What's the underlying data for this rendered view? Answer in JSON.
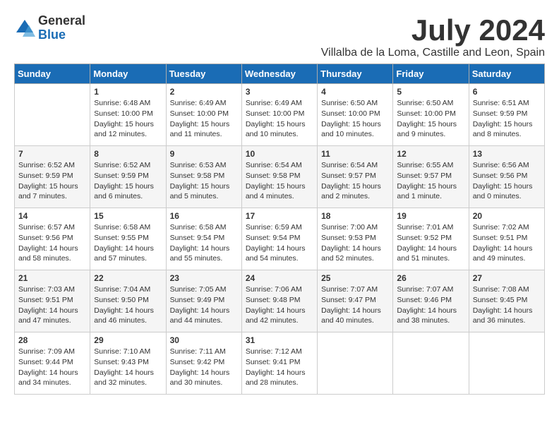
{
  "logo": {
    "general": "General",
    "blue": "Blue"
  },
  "title": "July 2024",
  "location": "Villalba de la Loma, Castille and Leon, Spain",
  "days_header": [
    "Sunday",
    "Monday",
    "Tuesday",
    "Wednesday",
    "Thursday",
    "Friday",
    "Saturday"
  ],
  "weeks": [
    [
      {
        "num": "",
        "info": ""
      },
      {
        "num": "1",
        "info": "Sunrise: 6:48 AM\nSunset: 10:00 PM\nDaylight: 15 hours\nand 12 minutes."
      },
      {
        "num": "2",
        "info": "Sunrise: 6:49 AM\nSunset: 10:00 PM\nDaylight: 15 hours\nand 11 minutes."
      },
      {
        "num": "3",
        "info": "Sunrise: 6:49 AM\nSunset: 10:00 PM\nDaylight: 15 hours\nand 10 minutes."
      },
      {
        "num": "4",
        "info": "Sunrise: 6:50 AM\nSunset: 10:00 PM\nDaylight: 15 hours\nand 10 minutes."
      },
      {
        "num": "5",
        "info": "Sunrise: 6:50 AM\nSunset: 10:00 PM\nDaylight: 15 hours\nand 9 minutes."
      },
      {
        "num": "6",
        "info": "Sunrise: 6:51 AM\nSunset: 9:59 PM\nDaylight: 15 hours\nand 8 minutes."
      }
    ],
    [
      {
        "num": "7",
        "info": "Sunrise: 6:52 AM\nSunset: 9:59 PM\nDaylight: 15 hours\nand 7 minutes."
      },
      {
        "num": "8",
        "info": "Sunrise: 6:52 AM\nSunset: 9:59 PM\nDaylight: 15 hours\nand 6 minutes."
      },
      {
        "num": "9",
        "info": "Sunrise: 6:53 AM\nSunset: 9:58 PM\nDaylight: 15 hours\nand 5 minutes."
      },
      {
        "num": "10",
        "info": "Sunrise: 6:54 AM\nSunset: 9:58 PM\nDaylight: 15 hours\nand 4 minutes."
      },
      {
        "num": "11",
        "info": "Sunrise: 6:54 AM\nSunset: 9:57 PM\nDaylight: 15 hours\nand 2 minutes."
      },
      {
        "num": "12",
        "info": "Sunrise: 6:55 AM\nSunset: 9:57 PM\nDaylight: 15 hours\nand 1 minute."
      },
      {
        "num": "13",
        "info": "Sunrise: 6:56 AM\nSunset: 9:56 PM\nDaylight: 15 hours\nand 0 minutes."
      }
    ],
    [
      {
        "num": "14",
        "info": "Sunrise: 6:57 AM\nSunset: 9:56 PM\nDaylight: 14 hours\nand 58 minutes."
      },
      {
        "num": "15",
        "info": "Sunrise: 6:58 AM\nSunset: 9:55 PM\nDaylight: 14 hours\nand 57 minutes."
      },
      {
        "num": "16",
        "info": "Sunrise: 6:58 AM\nSunset: 9:54 PM\nDaylight: 14 hours\nand 55 minutes."
      },
      {
        "num": "17",
        "info": "Sunrise: 6:59 AM\nSunset: 9:54 PM\nDaylight: 14 hours\nand 54 minutes."
      },
      {
        "num": "18",
        "info": "Sunrise: 7:00 AM\nSunset: 9:53 PM\nDaylight: 14 hours\nand 52 minutes."
      },
      {
        "num": "19",
        "info": "Sunrise: 7:01 AM\nSunset: 9:52 PM\nDaylight: 14 hours\nand 51 minutes."
      },
      {
        "num": "20",
        "info": "Sunrise: 7:02 AM\nSunset: 9:51 PM\nDaylight: 14 hours\nand 49 minutes."
      }
    ],
    [
      {
        "num": "21",
        "info": "Sunrise: 7:03 AM\nSunset: 9:51 PM\nDaylight: 14 hours\nand 47 minutes."
      },
      {
        "num": "22",
        "info": "Sunrise: 7:04 AM\nSunset: 9:50 PM\nDaylight: 14 hours\nand 46 minutes."
      },
      {
        "num": "23",
        "info": "Sunrise: 7:05 AM\nSunset: 9:49 PM\nDaylight: 14 hours\nand 44 minutes."
      },
      {
        "num": "24",
        "info": "Sunrise: 7:06 AM\nSunset: 9:48 PM\nDaylight: 14 hours\nand 42 minutes."
      },
      {
        "num": "25",
        "info": "Sunrise: 7:07 AM\nSunset: 9:47 PM\nDaylight: 14 hours\nand 40 minutes."
      },
      {
        "num": "26",
        "info": "Sunrise: 7:07 AM\nSunset: 9:46 PM\nDaylight: 14 hours\nand 38 minutes."
      },
      {
        "num": "27",
        "info": "Sunrise: 7:08 AM\nSunset: 9:45 PM\nDaylight: 14 hours\nand 36 minutes."
      }
    ],
    [
      {
        "num": "28",
        "info": "Sunrise: 7:09 AM\nSunset: 9:44 PM\nDaylight: 14 hours\nand 34 minutes."
      },
      {
        "num": "29",
        "info": "Sunrise: 7:10 AM\nSunset: 9:43 PM\nDaylight: 14 hours\nand 32 minutes."
      },
      {
        "num": "30",
        "info": "Sunrise: 7:11 AM\nSunset: 9:42 PM\nDaylight: 14 hours\nand 30 minutes."
      },
      {
        "num": "31",
        "info": "Sunrise: 7:12 AM\nSunset: 9:41 PM\nDaylight: 14 hours\nand 28 minutes."
      },
      {
        "num": "",
        "info": ""
      },
      {
        "num": "",
        "info": ""
      },
      {
        "num": "",
        "info": ""
      }
    ]
  ]
}
